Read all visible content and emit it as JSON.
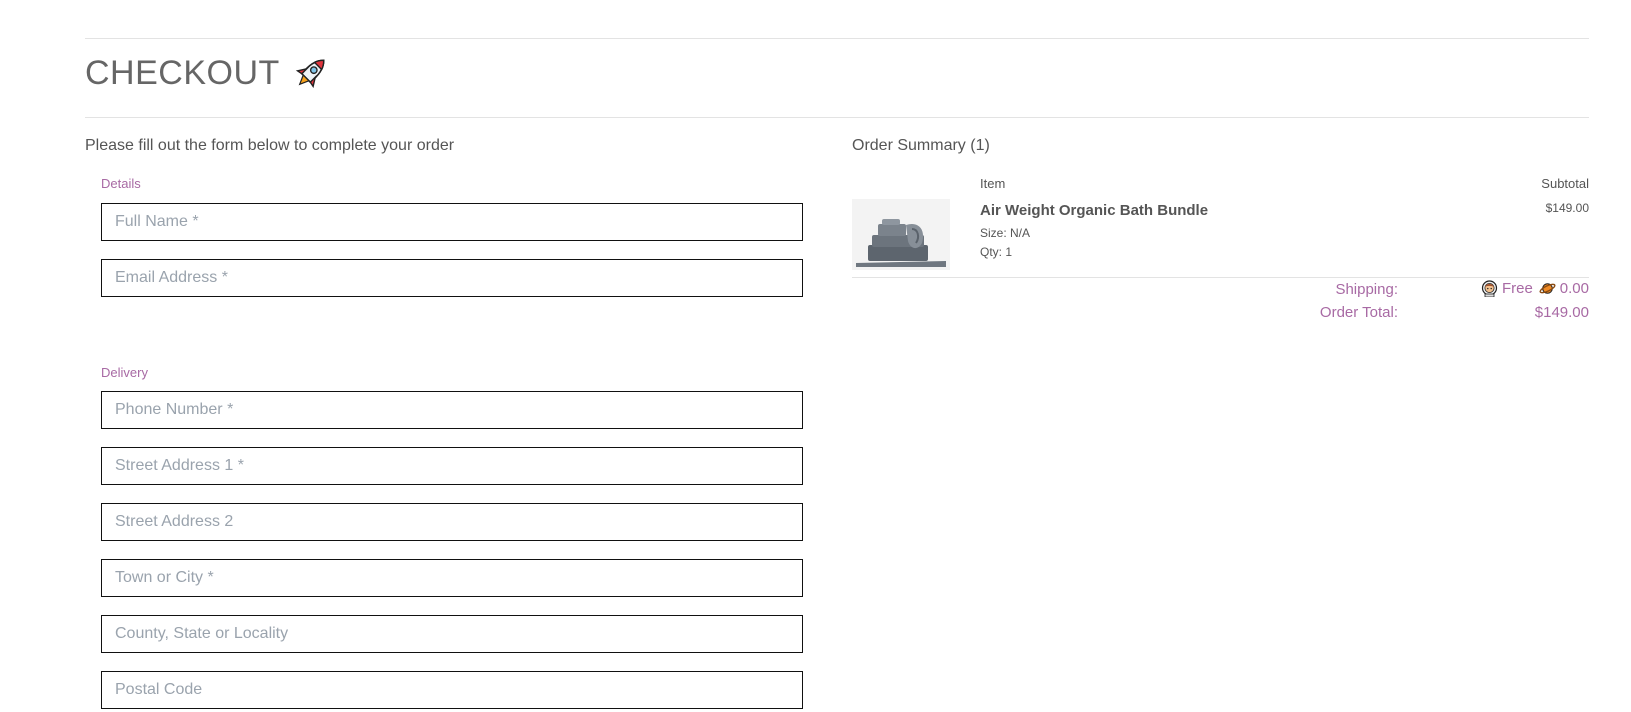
{
  "page": {
    "title": "CHECKOUT",
    "title_icon": "rocket-icon"
  },
  "form": {
    "intro": "Please fill out the form below to complete your order",
    "details": {
      "label": "Details",
      "full_name_placeholder": "Full Name *",
      "email_placeholder": "Email Address *"
    },
    "delivery": {
      "label": "Delivery",
      "phone_placeholder": "Phone Number *",
      "street1_placeholder": "Street Address 1 *",
      "street2_placeholder": "Street Address 2",
      "city_placeholder": "Town or City *",
      "county_placeholder": "County, State or Locality",
      "postal_placeholder": "Postal Code"
    }
  },
  "summary": {
    "title": "Order Summary (1)",
    "col_item": "Item",
    "col_subtotal": "Subtotal",
    "items": [
      {
        "name": "Air Weight Organic Bath Bundle",
        "size": "Size: N/A",
        "qty": "Qty: 1",
        "subtotal": "$149.00",
        "image_icon": "towel-bundle-image"
      }
    ],
    "shipping_label": "Shipping:",
    "shipping_value": "Free",
    "shipping_amount": "0.00",
    "shipping_icons": [
      "astronaut-icon",
      "planet-icon"
    ],
    "total_label": "Order Total:",
    "total_value": "$149.00"
  },
  "colors": {
    "accent": "#a86aa4",
    "text": "#555555",
    "placeholder": "#9aa3ad",
    "border": "#111111",
    "divider": "#e3e3e3"
  }
}
